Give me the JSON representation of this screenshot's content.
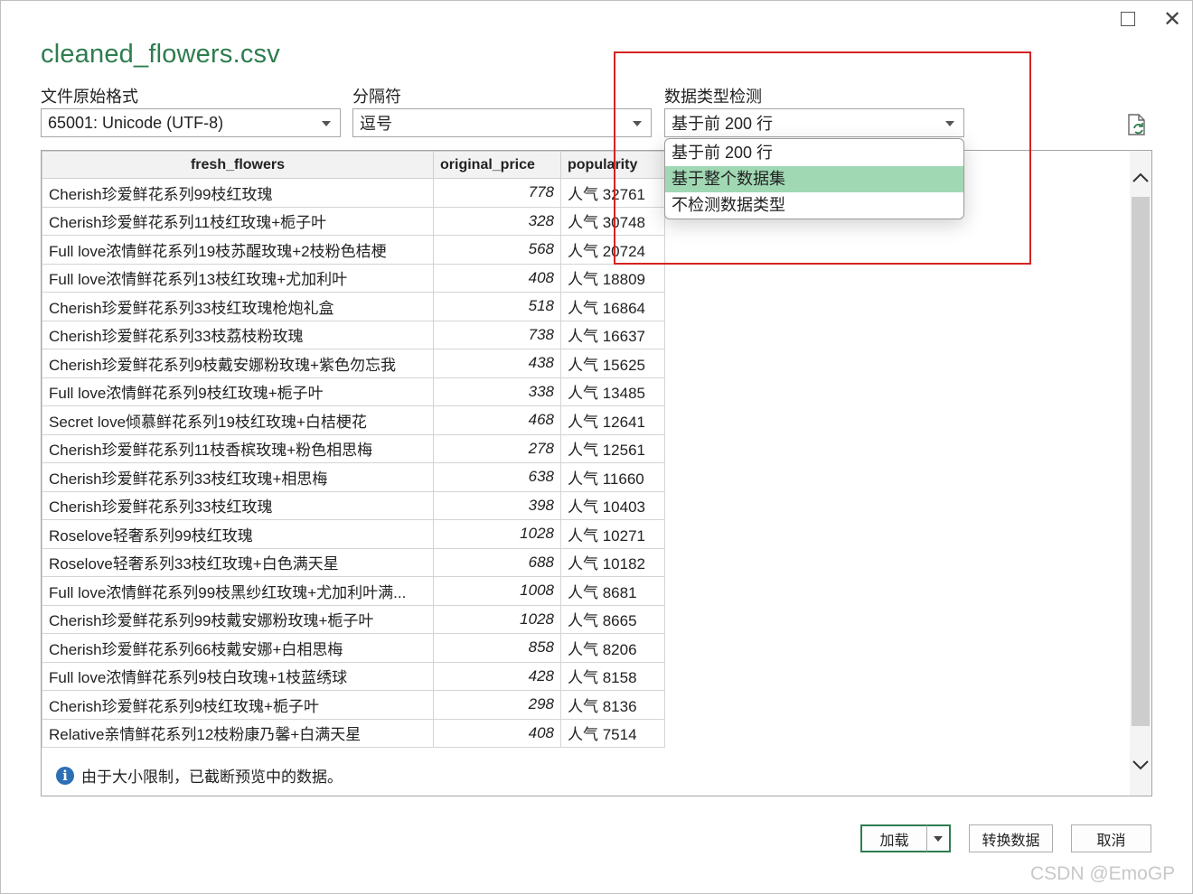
{
  "window": {
    "title": "cleaned_flowers.csv"
  },
  "file_origin": {
    "label": "文件原始格式",
    "value": "65001: Unicode (UTF-8)"
  },
  "delimiter": {
    "label": "分隔符",
    "value": "逗号"
  },
  "type_detection": {
    "label": "数据类型检测",
    "value": "基于前 200 行",
    "options": [
      "基于前 200 行",
      "基于整个数据集",
      "不检测数据类型"
    ],
    "highlighted_index": 1
  },
  "table": {
    "columns": [
      "fresh_flowers",
      "original_price",
      "popularity"
    ],
    "rows": [
      [
        "Cherish珍爱鲜花系列99枝红玫瑰",
        "778",
        "人气 32761"
      ],
      [
        "Cherish珍爱鲜花系列11枝红玫瑰+栀子叶",
        "328",
        "人气 30748"
      ],
      [
        "Full love浓情鲜花系列19枝苏醒玫瑰+2枝粉色桔梗",
        "568",
        "人气 20724"
      ],
      [
        "Full love浓情鲜花系列13枝红玫瑰+尤加利叶",
        "408",
        "人气 18809"
      ],
      [
        "Cherish珍爱鲜花系列33枝红玫瑰枪炮礼盒",
        "518",
        "人气 16864"
      ],
      [
        "Cherish珍爱鲜花系列33枝荔枝粉玫瑰",
        "738",
        "人气 16637"
      ],
      [
        "Cherish珍爱鲜花系列9枝戴安娜粉玫瑰+紫色勿忘我",
        "438",
        "人气 15625"
      ],
      [
        "Full love浓情鲜花系列9枝红玫瑰+栀子叶",
        "338",
        "人气 13485"
      ],
      [
        "Secret love倾慕鲜花系列19枝红玫瑰+白桔梗花",
        "468",
        "人气 12641"
      ],
      [
        "Cherish珍爱鲜花系列11枝香槟玫瑰+粉色相思梅",
        "278",
        "人气 12561"
      ],
      [
        "Cherish珍爱鲜花系列33枝红玫瑰+相思梅",
        "638",
        "人气 11660"
      ],
      [
        "Cherish珍爱鲜花系列33枝红玫瑰",
        "398",
        "人气 10403"
      ],
      [
        "Roselove轻奢系列99枝红玫瑰",
        "1028",
        "人气 10271"
      ],
      [
        "Roselove轻奢系列33枝红玫瑰+白色满天星",
        "688",
        "人气 10182"
      ],
      [
        "Full love浓情鲜花系列99枝黑纱红玫瑰+尤加利叶满...",
        "1008",
        "人气 8681"
      ],
      [
        "Cherish珍爱鲜花系列99枝戴安娜粉玫瑰+栀子叶",
        "1028",
        "人气 8665"
      ],
      [
        "Cherish珍爱鲜花系列66枝戴安娜+白相思梅",
        "858",
        "人气 8206"
      ],
      [
        "Full love浓情鲜花系列9枝白玫瑰+1枝蓝绣球",
        "428",
        "人气 8158"
      ],
      [
        "Cherish珍爱鲜花系列9枝红玫瑰+栀子叶",
        "298",
        "人气 8136"
      ],
      [
        "Relative亲情鲜花系列12枝粉康乃馨+白满天星",
        "408",
        "人气 7514"
      ]
    ]
  },
  "notice": {
    "text": "由于大小限制，已截断预览中的数据。"
  },
  "buttons": {
    "load": "加载",
    "transform": "转换数据",
    "cancel": "取消"
  },
  "watermark": "CSDN @EmoGP",
  "colors": {
    "accent": "#2e7d4f",
    "highlight": "#a0d8b3",
    "annotation_red": "#d42222",
    "info_blue": "#2c6fb5"
  }
}
